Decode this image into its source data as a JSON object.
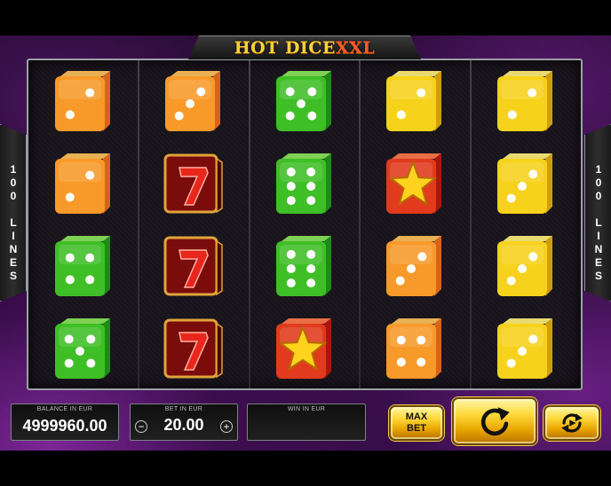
{
  "game": {
    "title_main": "HOT DICE",
    "title_accent": "XXL",
    "lines_left": "100 LINES",
    "lines_right": "100 LINES"
  },
  "reels": [
    [
      {
        "type": "dice",
        "color": "orange",
        "pips": 2
      },
      {
        "type": "dice",
        "color": "orange",
        "pips": 2
      },
      {
        "type": "dice",
        "color": "green",
        "pips": 4
      },
      {
        "type": "dice",
        "color": "green",
        "pips": 5
      }
    ],
    [
      {
        "type": "dice",
        "color": "orange",
        "pips": 3
      },
      {
        "type": "seven",
        "color": "red"
      },
      {
        "type": "seven",
        "color": "red"
      },
      {
        "type": "seven",
        "color": "red"
      }
    ],
    [
      {
        "type": "dice",
        "color": "green",
        "pips": 5
      },
      {
        "type": "dice",
        "color": "green",
        "pips": 6
      },
      {
        "type": "dice",
        "color": "green",
        "pips": 6
      },
      {
        "type": "star",
        "color": "red"
      }
    ],
    [
      {
        "type": "dice",
        "color": "yellow",
        "pips": 2
      },
      {
        "type": "star",
        "color": "red"
      },
      {
        "type": "dice",
        "color": "orange",
        "pips": 3
      },
      {
        "type": "dice",
        "color": "orange",
        "pips": 4
      }
    ],
    [
      {
        "type": "dice",
        "color": "yellow",
        "pips": 2
      },
      {
        "type": "dice",
        "color": "yellow",
        "pips": 3
      },
      {
        "type": "dice",
        "color": "yellow",
        "pips": 3
      },
      {
        "type": "dice",
        "color": "yellow",
        "pips": 3
      }
    ]
  ],
  "colors": {
    "orange": {
      "front": "#f79a2a",
      "side": "#d9631a",
      "top": "#ffc25a"
    },
    "green": {
      "front": "#3fbf26",
      "side": "#1f8a18",
      "top": "#8ae65a"
    },
    "yellow": {
      "front": "#f6d21c",
      "side": "#d29d08",
      "top": "#fff07a"
    },
    "red": {
      "front": "#e23a1c",
      "side": "#a8170c",
      "top": "#ff7a4a"
    },
    "seven_bg": "#7a0c0c",
    "seven_border": "#e0a43a",
    "star": "#ffd21e"
  },
  "balance": {
    "label": "BALANCE IN EUR",
    "value": "4999960.00"
  },
  "bet": {
    "label": "BET IN EUR",
    "value": "20.00",
    "minus": "−",
    "plus": "+"
  },
  "win": {
    "label": "WIN IN EUR",
    "value": ""
  },
  "buttons": {
    "max_bet_line1": "MAX",
    "max_bet_line2": "BET",
    "spin_icon": "refresh-icon",
    "autoplay_icon": "autoplay-icon"
  }
}
